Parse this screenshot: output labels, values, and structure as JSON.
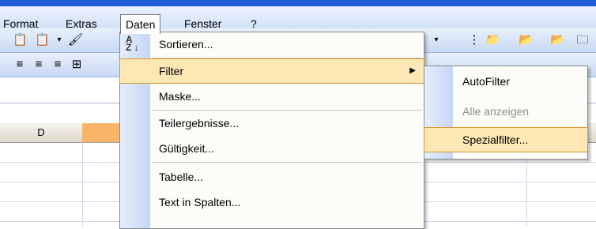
{
  "menubar": {
    "items": [
      "Format",
      "Extras",
      "Daten",
      "Fenster",
      "?"
    ]
  },
  "daten_menu": {
    "items": [
      "Sortieren...",
      "Filter",
      "Maske...",
      "Teilergebnisse...",
      "Gültigkeit...",
      "Tabelle...",
      "Text in Spalten..."
    ],
    "highlighted": "Filter"
  },
  "filter_submenu": {
    "items": [
      "AutoFilter",
      "Alle anzeigen",
      "Spezialfilter..."
    ],
    "disabled": [
      "Alle anzeigen"
    ],
    "highlighted": "Spezialfilter..."
  },
  "sheet": {
    "column_header": "D"
  },
  "colors": {
    "highlight": "#fde7b5",
    "highlight_border": "#d9982d",
    "active_column": "#f9b466",
    "menu_gutter": "#c5d6f5"
  }
}
